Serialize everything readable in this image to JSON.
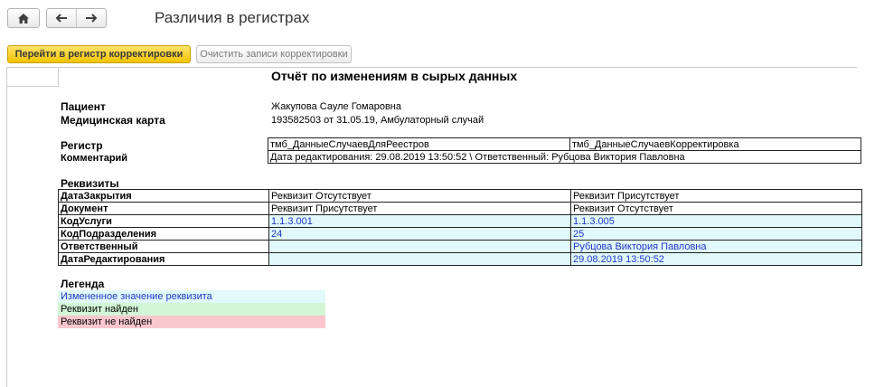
{
  "window": {
    "title": "Различия в регистрах"
  },
  "toolbar": {
    "primary_button": "Перейти в регистр корректировки",
    "secondary_button": "Очистить записи корректировки"
  },
  "report": {
    "title": "Отчёт по изменениям в сырых данных",
    "patient_label": "Пациент",
    "patient_value": "Жакупова Сауле Гомаровна",
    "card_label": "Медицинская карта",
    "card_value": "193582503 от 31.05.19, Амбулаторный случай",
    "register_label": "Регистр",
    "register_left": "тмб_ДанныеСлучаевДляРеестров",
    "register_right": "тмб_ДанныеСлучаевКорректировка",
    "comment_label": "Комментарий",
    "comment_value": "Дата редактирования: 29.08.2019 13:50:52 \\ Ответственный: Рубцова Виктория Павловна",
    "requisites_title": "Реквизиты",
    "rows": [
      {
        "name": "ДатаЗакрытия",
        "left": "Реквизит Отсутствует",
        "right": "Реквизит Присутствует",
        "style": "plain"
      },
      {
        "name": "Документ",
        "left": "Реквизит Присутствует",
        "right": "Реквизит Отсутствует",
        "style": "plain"
      },
      {
        "name": "КодУслуги",
        "left": "1.1.3.001",
        "right": "1.1.3.005",
        "style": "changed"
      },
      {
        "name": "КодПодразделения",
        "left": "24",
        "right": "25",
        "style": "changed"
      },
      {
        "name": "Ответственный",
        "left": "",
        "right": "Рубцова Виктория Павловна",
        "style": "changed"
      },
      {
        "name": "ДатаРедактирования",
        "left": "",
        "right": "29.08.2019 13:50:52",
        "style": "changed"
      }
    ],
    "legend_title": "Легенда",
    "legend": [
      {
        "label": "Измененное значение реквизита",
        "color": "#e2f9fb"
      },
      {
        "label": "Реквизит найден",
        "color": "#d3f7d6"
      },
      {
        "label": "Реквизит не найден",
        "color": "#fbc7cf"
      }
    ]
  },
  "colors": {
    "accent": "#f2c300",
    "changed_bg": "#e2f9fb",
    "changed_text": "#1e37c9",
    "found_bg": "#d3f7d6",
    "missing_bg": "#fbc7cf"
  }
}
